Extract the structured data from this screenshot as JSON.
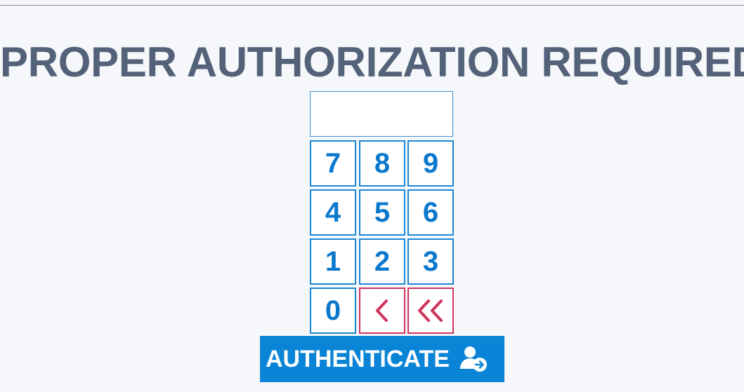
{
  "title": "PROPER AUTHORIZATION REQUIRED!",
  "display": {
    "value": ""
  },
  "keypad": {
    "k7": "7",
    "k8": "8",
    "k9": "9",
    "k4": "4",
    "k5": "5",
    "k6": "6",
    "k1": "1",
    "k2": "2",
    "k3": "3",
    "k0": "0"
  },
  "authenticate": {
    "label": "AUTHENTICATE",
    "icon": "user-arrow-icon"
  },
  "colors": {
    "background": "#f5f7fa",
    "title": "#536279",
    "key_border": "#1a87d6",
    "key_text": "#0a78cc",
    "delete": "#d0345b",
    "button": "#0a84d6"
  }
}
